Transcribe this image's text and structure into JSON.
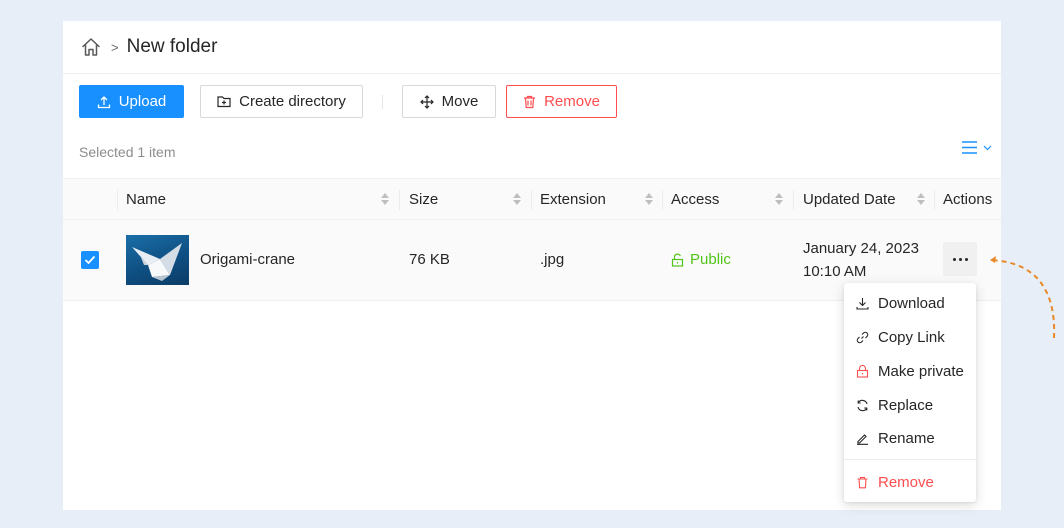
{
  "breadcrumb": {
    "separator": ">",
    "current": "New folder",
    "home_icon": "home-icon"
  },
  "toolbar": {
    "upload_label": "Upload",
    "create_directory_label": "Create directory",
    "move_label": "Move",
    "remove_label": "Remove"
  },
  "selection": {
    "text": "Selected 1 item"
  },
  "table": {
    "columns": [
      "Name",
      "Size",
      "Extension",
      "Access",
      "Updated Date",
      "Actions"
    ],
    "rows": [
      {
        "selected": true,
        "name": "Origami-crane",
        "size": "76 KB",
        "extension": ".jpg",
        "access": "Public",
        "updated_date": "January 24, 2023",
        "updated_time": "10:10 AM"
      }
    ]
  },
  "actions_menu": {
    "items": [
      {
        "label": "Download",
        "icon": "download-icon"
      },
      {
        "label": "Copy Link",
        "icon": "link-icon"
      },
      {
        "label": "Make private",
        "icon": "lock-icon"
      },
      {
        "label": "Replace",
        "icon": "refresh-icon"
      },
      {
        "label": "Rename",
        "icon": "edit-icon"
      },
      {
        "label": "Remove",
        "icon": "trash-icon"
      }
    ]
  },
  "colors": {
    "primary": "#1890ff",
    "danger": "#ff4d4f",
    "success": "#52c41a",
    "annotation_arrow": "#e8892a"
  }
}
